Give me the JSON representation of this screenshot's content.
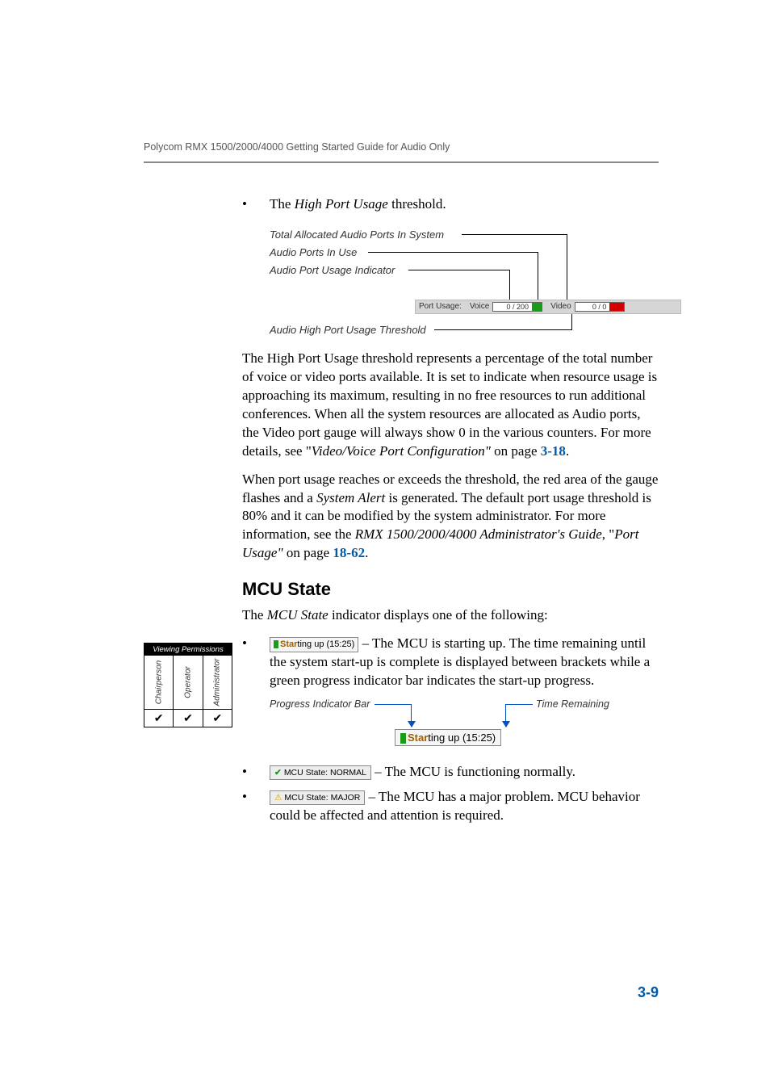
{
  "running_head": "Polycom RMX 1500/2000/4000 Getting Started Guide for Audio Only",
  "bullet_hpu_pre": "The ",
  "bullet_hpu_italic": "High Port Usage",
  "bullet_hpu_post": " threshold.",
  "diag1": {
    "l1": "Total Allocated Audio Ports In System",
    "l2": "Audio Ports In Use",
    "l3": "Audio Port Usage Indicator",
    "l4": "Audio High Port Usage Threshold",
    "pu_label": "Port Usage:",
    "pu_voice": "Voice",
    "pu_voice_val": "0 / 200",
    "pu_video": "Video",
    "pu_video_val": "0 / 0"
  },
  "para1a": "The High Port Usage threshold represents a percentage of the total number of voice or video ports available. It is set to indicate when resource usage is approaching its maximum, resulting in no free resources to run additional conferences.  When all the system resources are allocated as Audio ports, the Video port gauge will always show 0 in the various counters. For more details, see \"",
  "para1b_italic": "Video/Voice Port Configuration\"",
  "para1c": " on page ",
  "para1d_link": "3-18",
  "para1e": ".",
  "para2a": "When port usage reaches or exceeds the threshold, the red area of the gauge flashes and a ",
  "para2b_italic": "System Alert",
  "para2c": " is generated. The default port usage threshold is 80% and it can be modified by the system administrator. For more information, see the ",
  "para2d_italic": "RMX 1500/2000/4000 Administrator's Guide",
  "para2e": ", \"",
  "para2f_italic": "Port Usage\"",
  "para2g": " on page ",
  "para2h_link": "18-62",
  "para2i": ".",
  "perm": {
    "head": "Viewing Permissions",
    "c1": "Chairperson",
    "c2": "Operator",
    "c3": "Administrator",
    "chk": "✔"
  },
  "section_h": "MCU State",
  "mcu_intro_a": "The ",
  "mcu_intro_b": "MCU State",
  "mcu_intro_c": " indicator displays one of the following:",
  "starting_badge_text": "Starting up (15:25)",
  "b1_text": " – The MCU is starting up. The time remaining until the system start-up is complete is displayed between brackets while a green progress indicator bar indicates the start-up progress.",
  "diag2": {
    "pi": "Progress Indicator Bar",
    "tr": "Time Remaining",
    "badge_bold": "Star",
    "badge_rest": "ting up (15:25)"
  },
  "normal_badge": "MCU State: NORMAL",
  "b2_text": " – The MCU is functioning normally.",
  "major_badge": "MCU State: MAJOR",
  "b3_text": " – The MCU has a major problem. MCU behavior could be affected and attention is required.",
  "page_num": "3-9"
}
